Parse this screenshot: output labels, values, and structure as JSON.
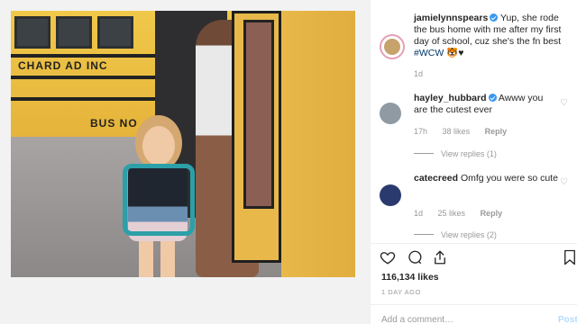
{
  "post": {
    "author": "jamielynnspears",
    "caption": "Yup, she rode the bus home with me after my first day of school, cuz she's the fn best",
    "hashtag": "#WCW",
    "caption_emoji": "🐯♥",
    "caption_age": "1d",
    "likes": "116,134 likes",
    "date": "1 DAY AGO",
    "add_comment_placeholder": "Add a comment…",
    "post_label": "Post"
  },
  "photo": {
    "bus_text_1": "CHARD AD INC",
    "bus_text_2": "BUS NO"
  },
  "comments": [
    {
      "username": "hayley_hubbard",
      "verified": true,
      "text": "Awww you are the cutest ever",
      "age": "17h",
      "likes": "38 likes",
      "reply_label": "Reply",
      "view_replies": "View replies (1)"
    },
    {
      "username": "catecreed",
      "verified": false,
      "text": "Omfg you were so cute",
      "age": "1d",
      "likes": "25 likes",
      "reply_label": "Reply",
      "view_replies": "View replies (2)"
    }
  ],
  "icons": {
    "like": "heart-icon",
    "comment": "comment-icon",
    "share": "share-icon",
    "save": "bookmark-icon"
  },
  "colors": {
    "verified": "#3897f0",
    "text": "#262626",
    "muted": "#999999",
    "post_button": "#b3dbff"
  }
}
